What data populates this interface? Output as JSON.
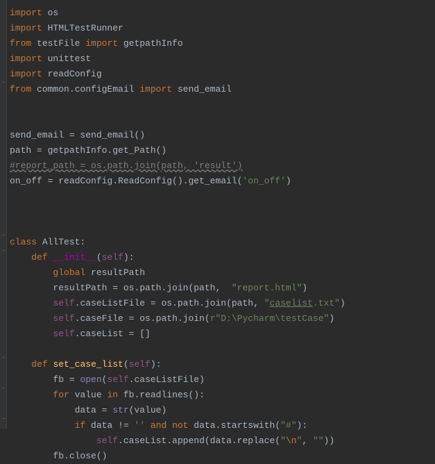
{
  "code": {
    "lines": [
      {
        "tokens": [
          {
            "t": "import ",
            "c": "k-import"
          },
          {
            "t": "os",
            "c": "ident"
          }
        ]
      },
      {
        "tokens": [
          {
            "t": "import ",
            "c": "k-import"
          },
          {
            "t": "HTMLTestRunner",
            "c": "ident"
          }
        ]
      },
      {
        "tokens": [
          {
            "t": "from ",
            "c": "k-import"
          },
          {
            "t": "testFile ",
            "c": "ident"
          },
          {
            "t": "import ",
            "c": "k-import"
          },
          {
            "t": "getpathInfo",
            "c": "ident"
          }
        ]
      },
      {
        "tokens": [
          {
            "t": "import ",
            "c": "k-import"
          },
          {
            "t": "unittest",
            "c": "ident"
          }
        ]
      },
      {
        "tokens": [
          {
            "t": "import ",
            "c": "k-import"
          },
          {
            "t": "readConfig",
            "c": "ident"
          }
        ]
      },
      {
        "tokens": [
          {
            "t": "from ",
            "c": "k-import"
          },
          {
            "t": "common.configEmail ",
            "c": "ident"
          },
          {
            "t": "import ",
            "c": "k-import"
          },
          {
            "t": "send_email",
            "c": "ident"
          }
        ]
      },
      {
        "tokens": []
      },
      {
        "tokens": []
      },
      {
        "tokens": [
          {
            "t": "send_email = send_email()",
            "c": "ident"
          }
        ]
      },
      {
        "tokens": [
          {
            "t": "path = getpathInfo.get_Path()",
            "c": "ident"
          }
        ]
      },
      {
        "tokens": [
          {
            "t": "#report_path = os.path.join(path, 'result')",
            "c": "comment-underline"
          }
        ]
      },
      {
        "tokens": [
          {
            "t": "on_off = readConfig.ReadConfig().get_email(",
            "c": "ident"
          },
          {
            "t": "'on_off'",
            "c": "string"
          },
          {
            "t": ")",
            "c": "ident"
          }
        ]
      },
      {
        "tokens": []
      },
      {
        "tokens": []
      },
      {
        "tokens": []
      },
      {
        "tokens": [
          {
            "t": "class ",
            "c": "k-class"
          },
          {
            "t": "AllTest:",
            "c": "ident"
          }
        ]
      },
      {
        "tokens": [
          {
            "t": "    ",
            "c": ""
          },
          {
            "t": "def ",
            "c": "k-def"
          },
          {
            "t": "__init__",
            "c": "magic"
          },
          {
            "t": "(",
            "c": "ident"
          },
          {
            "t": "self",
            "c": "k-self"
          },
          {
            "t": "):",
            "c": "ident"
          }
        ]
      },
      {
        "tokens": [
          {
            "t": "        ",
            "c": ""
          },
          {
            "t": "global ",
            "c": "k-keyword"
          },
          {
            "t": "resultPath",
            "c": "global-var"
          }
        ]
      },
      {
        "tokens": [
          {
            "t": "        ",
            "c": ""
          },
          {
            "t": "resultPath = os.path.join(path",
            "c": "ident"
          },
          {
            "t": ",  ",
            "c": "ident"
          },
          {
            "t": "\"report.html\"",
            "c": "string"
          },
          {
            "t": ")",
            "c": "ident"
          }
        ]
      },
      {
        "tokens": [
          {
            "t": "        ",
            "c": ""
          },
          {
            "t": "self",
            "c": "k-self"
          },
          {
            "t": ".caseListFile = os.path.join(path",
            "c": "ident"
          },
          {
            "t": ", ",
            "c": "ident"
          },
          {
            "t": "\"",
            "c": "string"
          },
          {
            "t": "caselist",
            "c": "string underline"
          },
          {
            "t": ".txt\"",
            "c": "string"
          },
          {
            "t": ")",
            "c": "ident"
          }
        ]
      },
      {
        "tokens": [
          {
            "t": "        ",
            "c": ""
          },
          {
            "t": "self",
            "c": "k-self"
          },
          {
            "t": ".caseFile = os.path.join(",
            "c": "ident"
          },
          {
            "t": "r\"D:\\Pycharm\\testCase\"",
            "c": "string"
          },
          {
            "t": ")",
            "c": "ident"
          }
        ]
      },
      {
        "tokens": [
          {
            "t": "        ",
            "c": ""
          },
          {
            "t": "self",
            "c": "k-self"
          },
          {
            "t": ".caseList = []",
            "c": "ident"
          }
        ]
      },
      {
        "tokens": []
      },
      {
        "tokens": [
          {
            "t": "    ",
            "c": ""
          },
          {
            "t": "def ",
            "c": "k-def"
          },
          {
            "t": "set_case_list",
            "c": "func-name"
          },
          {
            "t": "(",
            "c": "ident"
          },
          {
            "t": "self",
            "c": "k-self"
          },
          {
            "t": "):",
            "c": "ident"
          }
        ]
      },
      {
        "tokens": [
          {
            "t": "        ",
            "c": ""
          },
          {
            "t": "fb = ",
            "c": "ident"
          },
          {
            "t": "open",
            "c": "k-builtin"
          },
          {
            "t": "(",
            "c": "ident"
          },
          {
            "t": "self",
            "c": "k-self"
          },
          {
            "t": ".caseListFile)",
            "c": "ident"
          }
        ]
      },
      {
        "tokens": [
          {
            "t": "        ",
            "c": ""
          },
          {
            "t": "for ",
            "c": "k-keyword"
          },
          {
            "t": "value ",
            "c": "ident"
          },
          {
            "t": "in ",
            "c": "k-keyword"
          },
          {
            "t": "fb.readlines():",
            "c": "ident"
          }
        ]
      },
      {
        "tokens": [
          {
            "t": "            ",
            "c": ""
          },
          {
            "t": "data = ",
            "c": "ident"
          },
          {
            "t": "str",
            "c": "k-builtin"
          },
          {
            "t": "(value)",
            "c": "ident"
          }
        ]
      },
      {
        "tokens": [
          {
            "t": "            ",
            "c": ""
          },
          {
            "t": "if ",
            "c": "k-keyword"
          },
          {
            "t": "data != ",
            "c": "ident"
          },
          {
            "t": "''",
            "c": "string"
          },
          {
            "t": " ",
            "c": "ident"
          },
          {
            "t": "and not ",
            "c": "k-keyword"
          },
          {
            "t": "data.startswith(",
            "c": "ident"
          },
          {
            "t": "\"#\"",
            "c": "string"
          },
          {
            "t": "):",
            "c": "ident"
          }
        ]
      },
      {
        "tokens": [
          {
            "t": "                ",
            "c": ""
          },
          {
            "t": "self",
            "c": "k-self"
          },
          {
            "t": ".caseList.append(data.replace(",
            "c": "ident"
          },
          {
            "t": "\"",
            "c": "string"
          },
          {
            "t": "\\n",
            "c": "string-escape"
          },
          {
            "t": "\"",
            "c": "string"
          },
          {
            "t": ", ",
            "c": "ident"
          },
          {
            "t": "\"\"",
            "c": "string"
          },
          {
            "t": "))",
            "c": "ident"
          }
        ]
      },
      {
        "tokens": [
          {
            "t": "        ",
            "c": ""
          },
          {
            "t": "fb.close()",
            "c": "ident"
          }
        ]
      }
    ]
  }
}
